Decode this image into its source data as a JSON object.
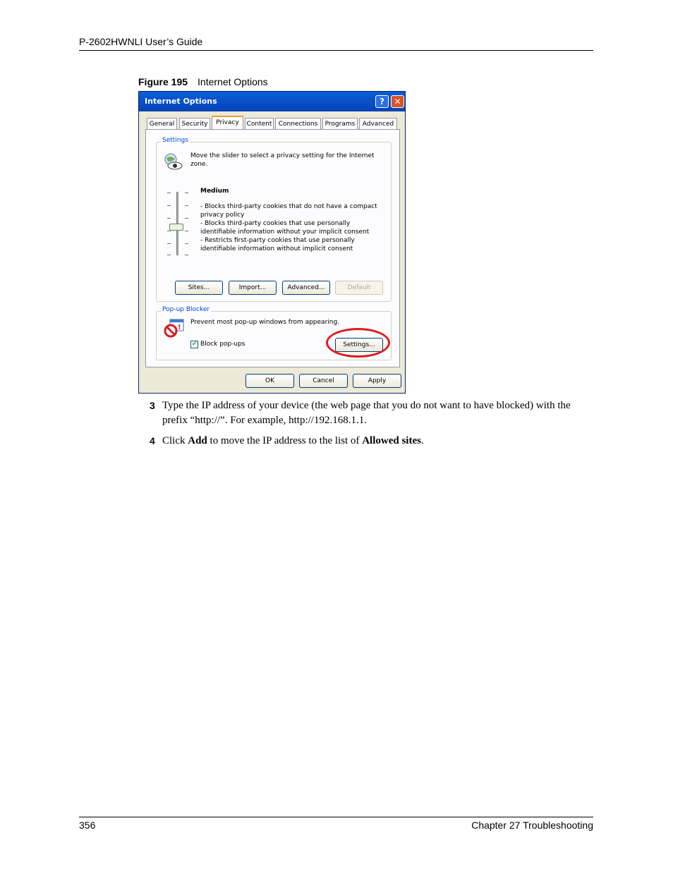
{
  "header": {
    "guide_title": "P-2602HWNLI User’s Guide"
  },
  "footer": {
    "page_number": "356",
    "chapter": "Chapter 27 Troubleshooting"
  },
  "figure": {
    "label": "Figure 195",
    "title": "Internet Options"
  },
  "dialog": {
    "title": "Internet Options",
    "help_glyph": "?",
    "close_glyph": "✕",
    "tabs": [
      {
        "label": "General"
      },
      {
        "label": "Security"
      },
      {
        "label": "Privacy"
      },
      {
        "label": "Content"
      },
      {
        "label": "Connections"
      },
      {
        "label": "Programs"
      },
      {
        "label": "Advanced"
      }
    ],
    "active_tab": "Privacy",
    "settings": {
      "group_label": "Settings",
      "intro": "Move the slider to select a privacy setting for the Internet zone.",
      "level": "Medium",
      "lines": [
        "- Blocks third-party cookies that do not have a compact privacy policy",
        "- Blocks third-party cookies that use personally identifiable information without your implicit consent",
        "- Restricts first-party cookies that use personally identifiable information without implicit consent"
      ],
      "buttons": {
        "sites": "Sites...",
        "import": "Import...",
        "advanced": "Advanced...",
        "default": "Default"
      }
    },
    "popup_blocker": {
      "group_label": "Pop-up Blocker",
      "description": "Prevent most pop-up windows from appearing.",
      "checkbox_label": "Block pop-ups",
      "checkbox_checked": true,
      "checkbox_glyph": "✔",
      "settings_button": "Settings..."
    },
    "footer_buttons": {
      "ok": "OK",
      "cancel": "Cancel",
      "apply": "Apply"
    },
    "highlight_color": "#e21a1a"
  },
  "steps": [
    {
      "number": "3",
      "segments": [
        {
          "text": "Type the IP address of your device (the web page that you do not want to have blocked) with the prefix “http://”. For example, http://192.168.1.1.",
          "bold": false
        }
      ]
    },
    {
      "number": "4",
      "segments": [
        {
          "text": "Click ",
          "bold": false
        },
        {
          "text": "Add",
          "bold": true
        },
        {
          "text": " to move the IP address to the list of ",
          "bold": false
        },
        {
          "text": "Allowed sites",
          "bold": true
        },
        {
          "text": ".",
          "bold": false
        }
      ]
    }
  ]
}
